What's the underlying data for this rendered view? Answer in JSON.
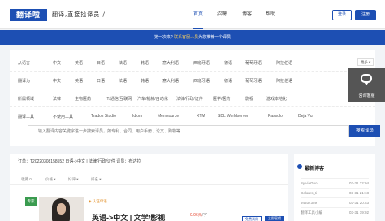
{
  "header": {
    "logo_text": "翻译啦",
    "slogan": "翻译,直接找译员 /",
    "nav": [
      "首页",
      "招聘",
      "博客",
      "帮助"
    ],
    "active_nav": 0,
    "login_label": "登录",
    "register_label": "注册"
  },
  "banner": {
    "prefix": "第一次来? ",
    "highlight": "联系客服人员",
    "suffix": "为您推荐一个译员"
  },
  "filters": {
    "more_label": "更多 ▾",
    "rows": [
      {
        "label": "从语言",
        "options": [
          "中文",
          "英语",
          "日语",
          "法语",
          "韩语",
          "意大利语",
          "西班牙语",
          "德语",
          "葡萄牙语",
          "阿拉伯语"
        ]
      },
      {
        "label": "翻译为",
        "options": [
          "中文",
          "英语",
          "日语",
          "法语",
          "韩语",
          "意大利语",
          "西班牙语",
          "德语",
          "葡萄牙语",
          "阿拉伯语"
        ]
      },
      {
        "label": "所属领域",
        "options": [
          "法律",
          "生物医药",
          "IT/通信/互联网",
          "汽车/机械/自动化",
          "法律/行政/证件",
          "医学/医药",
          "影视",
          "游戏本地化"
        ]
      },
      {
        "label": "翻译工具",
        "options": [
          "不使用工具",
          "Trados Studio",
          "Idiom",
          "Memsource",
          "XTM",
          "SDL Worldserver",
          "Passolo",
          "Deja Vu"
        ]
      }
    ]
  },
  "search": {
    "placeholder": "输入翻译内容关键字进一步搜索译员，如专利、合同、用户手册、论文、购物等",
    "button_label": "搜索译员"
  },
  "service": {
    "label": "咨询客服"
  },
  "order": {
    "text": "订单：T20220308158552    日语->中文 | 法律/行政/证件    译员：布达拉",
    "stats": [
      "收藏 0",
      "价格 ▾",
      "好评 ▾",
      "排名 ▾"
    ],
    "tag": "专家",
    "shield_tag": "◈ 认证母语",
    "title": "英语->中文 | 文学/影视",
    "price": "0.06元",
    "price_unit": "/字",
    "try_label": "免费试用",
    "hire_label": "立即雇佣"
  },
  "sidebar": {
    "heading": "最新博客",
    "items": [
      {
        "name": "SylviaGuo",
        "date": "03-31 22:04"
      },
      {
        "name": "Dolores_Ii",
        "date": "03-31 21:18"
      },
      {
        "name": "94937359",
        "date": "03-31 20:53"
      },
      {
        "name": "翻译工具小编",
        "date": "03-31 19:02"
      }
    ]
  }
}
